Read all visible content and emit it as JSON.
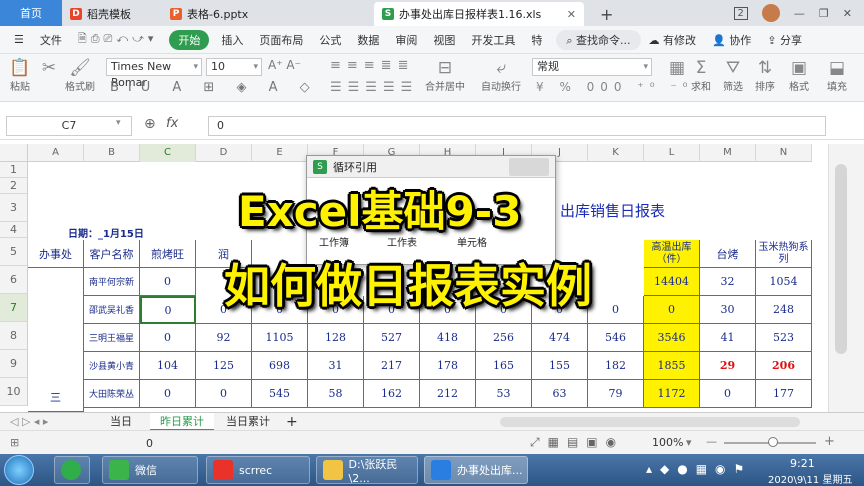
{
  "tabs": {
    "home": "首页",
    "template": "稻壳模板",
    "ppt": "表格-6.pptx",
    "xls": "办事处出库日报样表1.16.xls",
    "badge": "2"
  },
  "menu": [
    "文件",
    "开始",
    "插入",
    "页面布局",
    "公式",
    "数据",
    "审阅",
    "视图",
    "开发工具",
    "特"
  ],
  "menu_right": {
    "search": "查找命令...",
    "changes": "有修改",
    "collab": "协作",
    "share": "分享"
  },
  "ribbon": {
    "paste": "粘贴",
    "fmtpainter": "格式刷",
    "font": "Times New Romar",
    "size": "10",
    "merge": "合并居中",
    "wrap": "自动换行",
    "numfmt": "常规",
    "sum": "求和",
    "filter": "筛选",
    "sort": "排序",
    "format": "格式",
    "fill": "填充"
  },
  "formula": {
    "cellref": "C7",
    "fx": "fx",
    "value": "0"
  },
  "columns": [
    "A",
    "B",
    "C",
    "D",
    "E",
    "F",
    "G",
    "H",
    "I",
    "J",
    "K",
    "L",
    "M",
    "N"
  ],
  "rows": [
    "1",
    "2",
    "3",
    "4",
    "5",
    "6",
    "7",
    "8",
    "9",
    "10"
  ],
  "sheet": {
    "date_label": "日期：_1月15日",
    "title_tail": "出库销售日报表",
    "h_office": "办事处",
    "h_customer": "客户名称",
    "h_c": "煎烤旺",
    "h_d": "润",
    "h_l": "高温出库（件）",
    "h_m": "台烤",
    "h_n": "玉米热狗系列",
    "rows": [
      {
        "name": "南平何宗新",
        "c": "0",
        "l": "14404",
        "m": "32",
        "n": "1054"
      },
      {
        "name": "邵武吴礼香",
        "c": "0",
        "d": "0",
        "e": "0",
        "f": "0",
        "g": "0",
        "h": "0",
        "i": "0",
        "j": "0",
        "k": "0",
        "l": "0",
        "m": "30",
        "n": "248"
      },
      {
        "name": "三明王福星",
        "c": "0",
        "d": "92",
        "e": "1105",
        "f": "128",
        "g": "527",
        "h": "418",
        "i": "256",
        "j": "474",
        "k": "546",
        "l": "3546",
        "m": "41",
        "n": "523"
      },
      {
        "name": "沙县黄小青",
        "c": "104",
        "d": "125",
        "e": "698",
        "f": "31",
        "g": "217",
        "h": "178",
        "i": "165",
        "j": "155",
        "k": "182",
        "l": "1855",
        "m": "29",
        "n": "206"
      },
      {
        "name": "大田陈荣丛",
        "c": "0",
        "d": "0",
        "e": "545",
        "f": "58",
        "g": "162",
        "h": "212",
        "i": "53",
        "j": "63",
        "k": "79",
        "l": "1172",
        "m": "0",
        "n": "177"
      }
    ],
    "office_vertical": "三"
  },
  "dialog": {
    "title": "循环引用",
    "col1": "工作簿",
    "col2": "工作表",
    "col3": "单元格"
  },
  "caption": {
    "line1": "Excel基础9-3",
    "line2": "如何做日报表实例"
  },
  "sheet_tabs": [
    "当日",
    "昨日累计",
    "当日累计"
  ],
  "status": {
    "value": "0",
    "zoom": "100%"
  },
  "taskbar": {
    "wechat": "微信",
    "scrrec": "scrrec",
    "folder": "D:\\张跃民\\2...",
    "wps": "办事处出库...",
    "time": "9:21",
    "date": "2020\\9\\11 星期五"
  },
  "colors": {
    "accent": "#2e9d4f",
    "highlight": "#fff200",
    "cellText": "#1a2c8c",
    "red": "#e01010"
  }
}
